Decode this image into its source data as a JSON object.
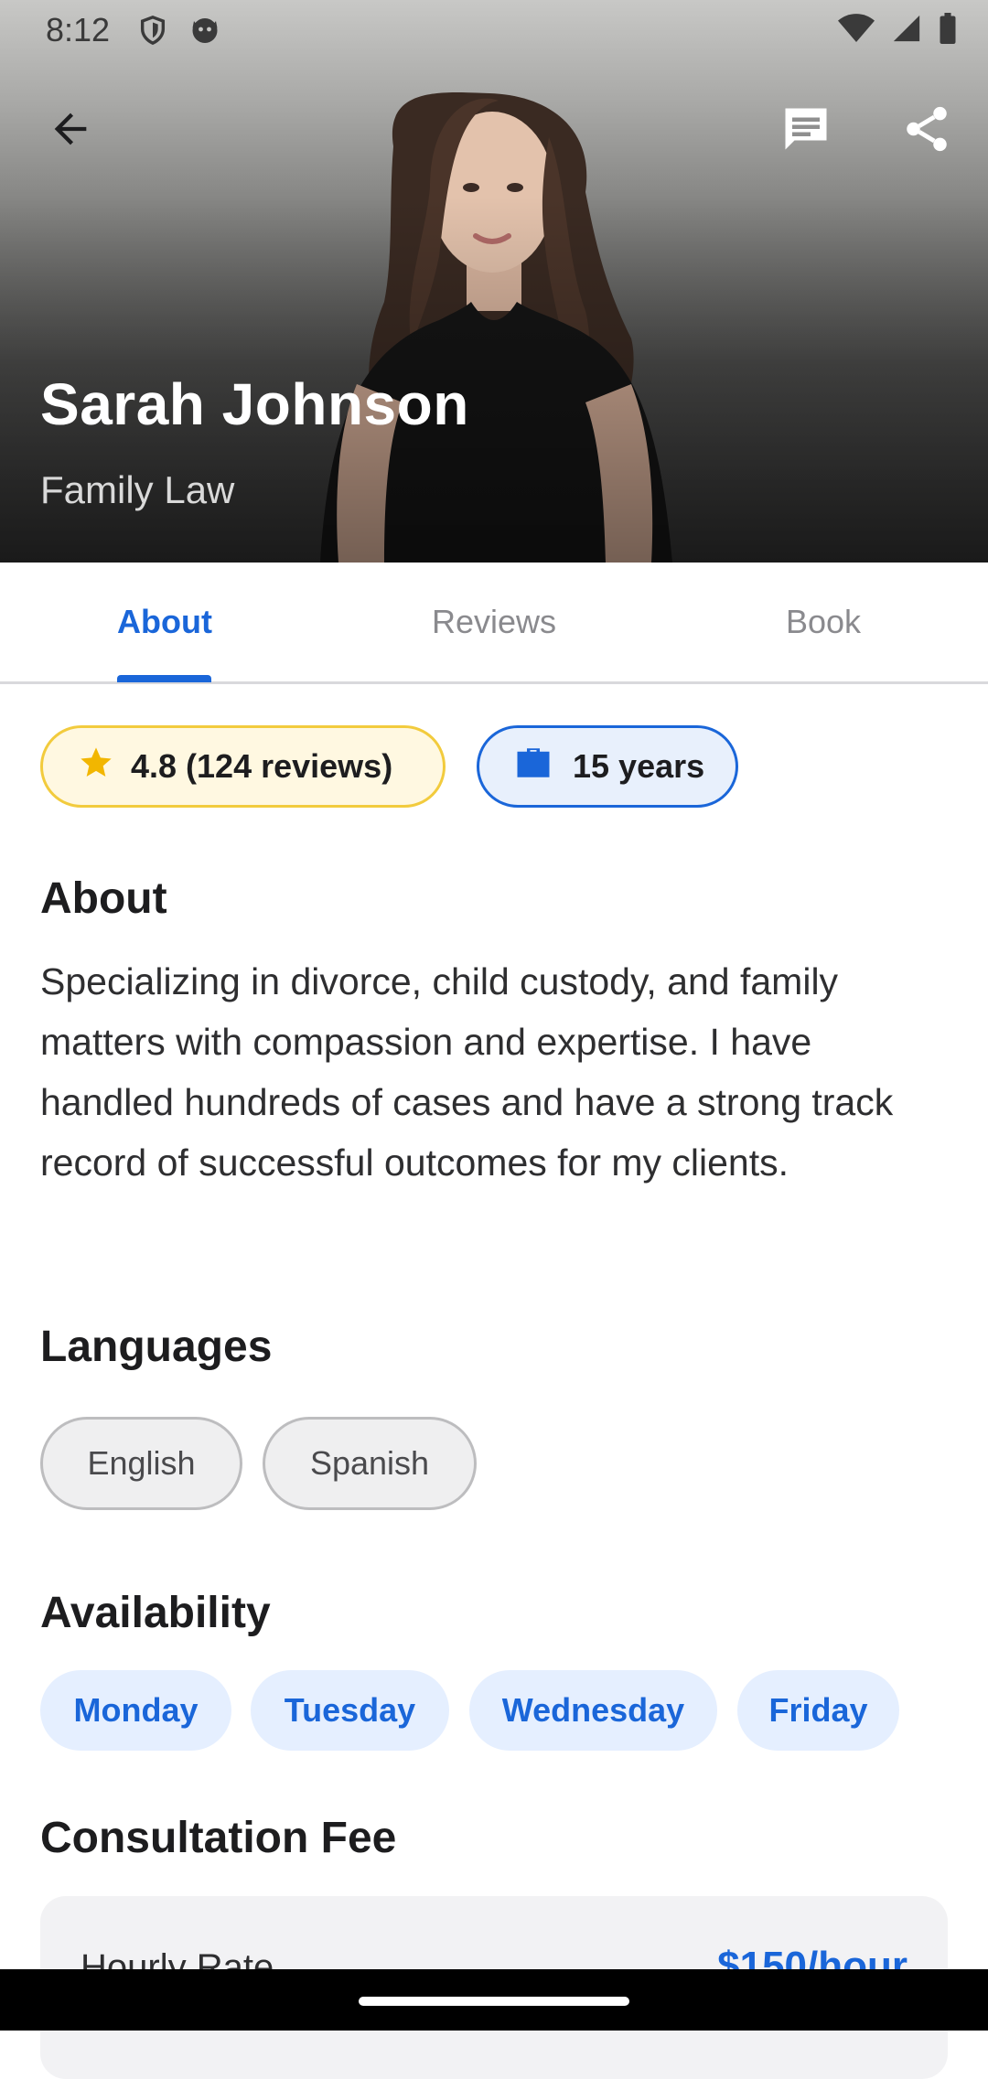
{
  "status_bar": {
    "time": "8:12",
    "left_icons": [
      "shield-icon",
      "cat-face-icon"
    ],
    "right_icons": [
      "wifi-icon",
      "cell-signal-icon",
      "battery-icon"
    ]
  },
  "header": {
    "name": "Sarah Johnson",
    "specialty": "Family Law",
    "actions": [
      "back-arrow-icon",
      "message-icon",
      "share-icon"
    ]
  },
  "tabs": [
    {
      "label": "About",
      "active": true
    },
    {
      "label": "Reviews",
      "active": false
    },
    {
      "label": "Book",
      "active": false
    }
  ],
  "stats": {
    "rating_text": "4.8 (124 reviews)",
    "experience_text": "15 years"
  },
  "about": {
    "title": "About",
    "text": "Specializing in divorce, child custody, and family matters with compassion and expertise. I have handled hundreds of cases and have a strong track record of successful outcomes for my clients."
  },
  "languages": {
    "title": "Languages",
    "items": [
      "English",
      "Spanish"
    ]
  },
  "availability": {
    "title": "Availability",
    "days": [
      "Monday",
      "Tuesday",
      "Wednesday",
      "Friday"
    ]
  },
  "fee": {
    "title": "Consultation Fee",
    "label": "Hourly Rate",
    "value": "$150/hour"
  },
  "colors": {
    "accent": "#1a66d9",
    "rating_bg": "#fff8e1",
    "rating_border": "#f2cb3d",
    "star": "#f2b600"
  }
}
